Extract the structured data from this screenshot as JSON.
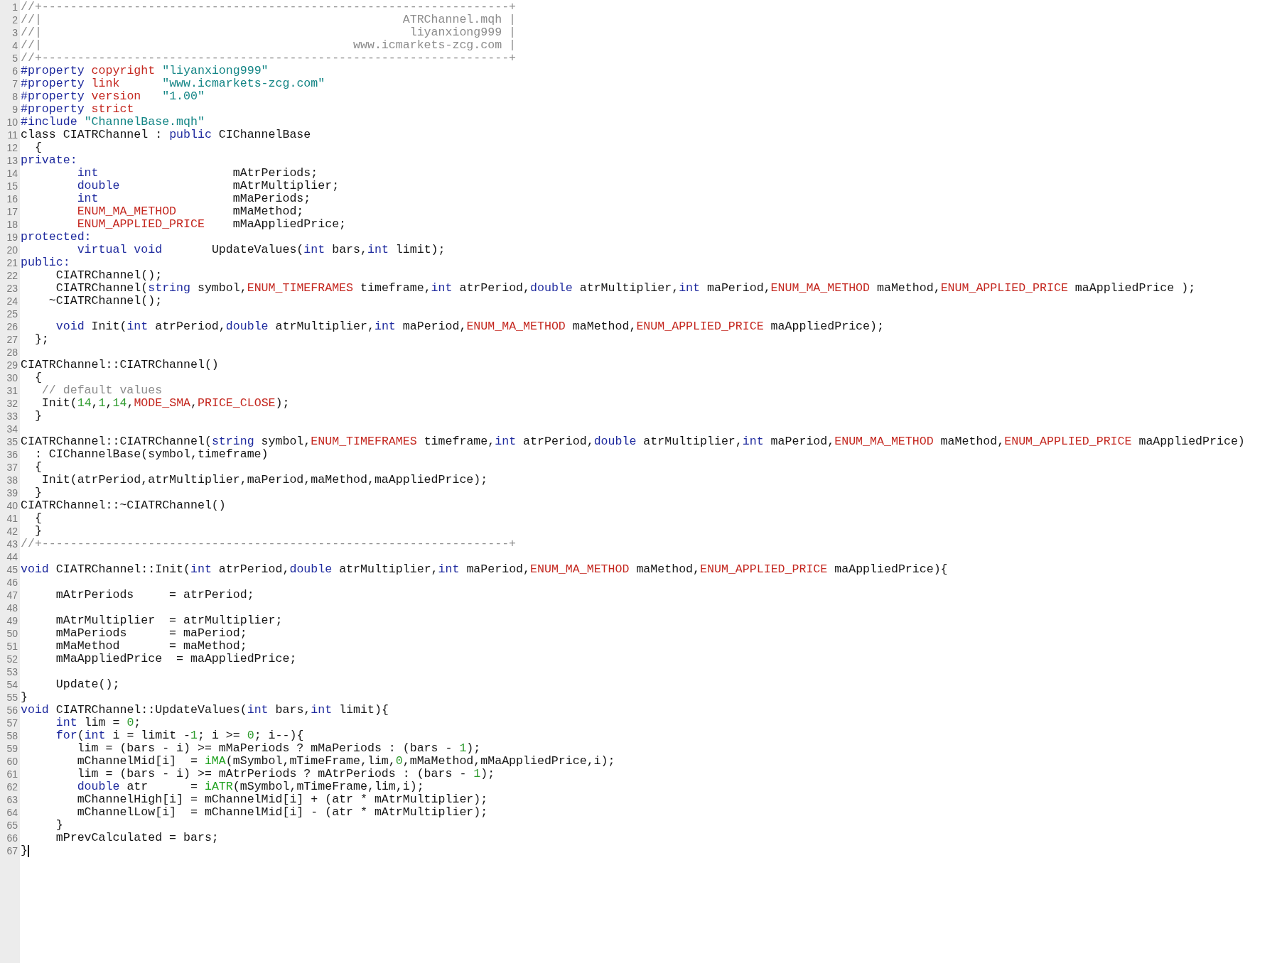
{
  "editor": {
    "lines": [
      {
        "number": "1",
        "caret": false,
        "segments": [
          {
            "text": "//+------------------------------------------------------------------+",
            "kind": "comment"
          }
        ]
      },
      {
        "number": "2",
        "caret": false,
        "segments": [
          {
            "text": "//|                                                   ATRChannel.mqh |",
            "kind": "comment"
          }
        ]
      },
      {
        "number": "3",
        "caret": false,
        "segments": [
          {
            "text": "//|                                                    liyanxiong999 |",
            "kind": "comment"
          }
        ]
      },
      {
        "number": "4",
        "caret": false,
        "segments": [
          {
            "text": "//|                                            www.icmarkets-zcg.com |",
            "kind": "comment"
          }
        ]
      },
      {
        "number": "5",
        "caret": false,
        "segments": [
          {
            "text": "//+------------------------------------------------------------------+",
            "kind": "comment"
          }
        ]
      },
      {
        "number": "6",
        "caret": false,
        "segments": [
          {
            "text": "#property ",
            "kind": "keyword"
          },
          {
            "text": "copyright",
            "kind": "type"
          },
          {
            "text": " \"liyanxiong999\"",
            "kind": "string"
          }
        ]
      },
      {
        "number": "7",
        "caret": false,
        "segments": [
          {
            "text": "#property ",
            "kind": "keyword"
          },
          {
            "text": "link",
            "kind": "type"
          },
          {
            "text": "      \"www.icmarkets-zcg.com\"",
            "kind": "string"
          }
        ]
      },
      {
        "number": "8",
        "caret": false,
        "segments": [
          {
            "text": "#property ",
            "kind": "keyword"
          },
          {
            "text": "version",
            "kind": "type"
          },
          {
            "text": "   \"1.00\"",
            "kind": "string"
          }
        ]
      },
      {
        "number": "9",
        "caret": false,
        "segments": [
          {
            "text": "#property ",
            "kind": "keyword"
          },
          {
            "text": "strict",
            "kind": "type"
          }
        ]
      },
      {
        "number": "10",
        "caret": false,
        "segments": [
          {
            "text": "#include ",
            "kind": "keyword"
          },
          {
            "text": "\"ChannelBase.mqh\"",
            "kind": "string"
          }
        ]
      },
      {
        "number": "11",
        "caret": false,
        "segments": [
          {
            "text": "class CIATRChannel : ",
            "kind": "plain"
          },
          {
            "text": "public",
            "kind": "keyword"
          },
          {
            "text": " CIChannelBase",
            "kind": "plain"
          }
        ]
      },
      {
        "number": "12",
        "caret": false,
        "segments": [
          {
            "text": "  {",
            "kind": "plain"
          }
        ]
      },
      {
        "number": "13",
        "caret": false,
        "segments": [
          {
            "text": "private:",
            "kind": "keyword"
          }
        ]
      },
      {
        "number": "14",
        "caret": false,
        "segments": [
          {
            "text": "        int",
            "kind": "keyword"
          },
          {
            "text": "                   mAtrPeriods;",
            "kind": "plain"
          }
        ]
      },
      {
        "number": "15",
        "caret": false,
        "segments": [
          {
            "text": "        double",
            "kind": "keyword"
          },
          {
            "text": "                mAtrMultiplier;",
            "kind": "plain"
          }
        ]
      },
      {
        "number": "16",
        "caret": false,
        "segments": [
          {
            "text": "        int",
            "kind": "keyword"
          },
          {
            "text": "                   mMaPeriods;",
            "kind": "plain"
          }
        ]
      },
      {
        "number": "17",
        "caret": false,
        "segments": [
          {
            "text": "        ENUM_MA_METHOD",
            "kind": "type"
          },
          {
            "text": "        mMaMethod;",
            "kind": "plain"
          }
        ]
      },
      {
        "number": "18",
        "caret": false,
        "segments": [
          {
            "text": "        ENUM_APPLIED_PRICE",
            "kind": "type"
          },
          {
            "text": "    mMaAppliedPrice;",
            "kind": "plain"
          }
        ]
      },
      {
        "number": "19",
        "caret": false,
        "segments": [
          {
            "text": "protected:",
            "kind": "keyword"
          }
        ]
      },
      {
        "number": "20",
        "caret": false,
        "segments": [
          {
            "text": "        virtual void",
            "kind": "keyword"
          },
          {
            "text": "       UpdateValues(",
            "kind": "plain"
          },
          {
            "text": "int",
            "kind": "keyword"
          },
          {
            "text": " bars,",
            "kind": "plain"
          },
          {
            "text": "int",
            "kind": "keyword"
          },
          {
            "text": " limit);",
            "kind": "plain"
          }
        ]
      },
      {
        "number": "21",
        "caret": false,
        "segments": [
          {
            "text": "public:",
            "kind": "keyword"
          }
        ]
      },
      {
        "number": "22",
        "caret": false,
        "segments": [
          {
            "text": "     CIATRChannel();",
            "kind": "plain"
          }
        ]
      },
      {
        "number": "23",
        "caret": false,
        "segments": [
          {
            "text": "     CIATRChannel(",
            "kind": "plain"
          },
          {
            "text": "string",
            "kind": "keyword"
          },
          {
            "text": " symbol,",
            "kind": "plain"
          },
          {
            "text": "ENUM_TIMEFRAMES",
            "kind": "type"
          },
          {
            "text": " timeframe,",
            "kind": "plain"
          },
          {
            "text": "int",
            "kind": "keyword"
          },
          {
            "text": " atrPeriod,",
            "kind": "plain"
          },
          {
            "text": "double",
            "kind": "keyword"
          },
          {
            "text": " atrMultiplier,",
            "kind": "plain"
          },
          {
            "text": "int",
            "kind": "keyword"
          },
          {
            "text": " maPeriod,",
            "kind": "plain"
          },
          {
            "text": "ENUM_MA_METHOD",
            "kind": "type"
          },
          {
            "text": " maMethod,",
            "kind": "plain"
          },
          {
            "text": "ENUM_APPLIED_PRICE",
            "kind": "type"
          },
          {
            "text": " maAppliedPrice );",
            "kind": "plain"
          }
        ]
      },
      {
        "number": "24",
        "caret": false,
        "segments": [
          {
            "text": "    ~CIATRChannel();",
            "kind": "plain"
          }
        ]
      },
      {
        "number": "25",
        "caret": false
      },
      {
        "number": "26",
        "caret": false,
        "segments": [
          {
            "text": "     void",
            "kind": "keyword"
          },
          {
            "text": " Init(",
            "kind": "plain"
          },
          {
            "text": "int",
            "kind": "keyword"
          },
          {
            "text": " atrPeriod,",
            "kind": "plain"
          },
          {
            "text": "double",
            "kind": "keyword"
          },
          {
            "text": " atrMultiplier,",
            "kind": "plain"
          },
          {
            "text": "int",
            "kind": "keyword"
          },
          {
            "text": " maPeriod,",
            "kind": "plain"
          },
          {
            "text": "ENUM_MA_METHOD",
            "kind": "type"
          },
          {
            "text": " maMethod,",
            "kind": "plain"
          },
          {
            "text": "ENUM_APPLIED_PRICE",
            "kind": "type"
          },
          {
            "text": " maAppliedPrice);",
            "kind": "plain"
          }
        ]
      },
      {
        "number": "27",
        "caret": false,
        "segments": [
          {
            "text": "  };",
            "kind": "plain"
          }
        ]
      },
      {
        "number": "28",
        "caret": false
      },
      {
        "number": "29",
        "caret": false,
        "segments": [
          {
            "text": "CIATRChannel::CIATRChannel()",
            "kind": "plain"
          }
        ]
      },
      {
        "number": "30",
        "caret": false,
        "segments": [
          {
            "text": "  {",
            "kind": "plain"
          }
        ]
      },
      {
        "number": "31",
        "caret": false,
        "segments": [
          {
            "text": "   // default values",
            "kind": "comment"
          }
        ]
      },
      {
        "number": "32",
        "caret": false,
        "segments": [
          {
            "text": "   Init(",
            "kind": "plain"
          },
          {
            "text": "14",
            "kind": "number"
          },
          {
            "text": ",",
            "kind": "plain"
          },
          {
            "text": "1",
            "kind": "number"
          },
          {
            "text": ",",
            "kind": "plain"
          },
          {
            "text": "14",
            "kind": "number"
          },
          {
            "text": ",",
            "kind": "plain"
          },
          {
            "text": "MODE_SMA",
            "kind": "type"
          },
          {
            "text": ",",
            "kind": "plain"
          },
          {
            "text": "PRICE_CLOSE",
            "kind": "type"
          },
          {
            "text": ");",
            "kind": "plain"
          }
        ]
      },
      {
        "number": "33",
        "caret": false,
        "segments": [
          {
            "text": "  }",
            "kind": "plain"
          }
        ]
      },
      {
        "number": "34",
        "caret": false
      },
      {
        "number": "35",
        "caret": false,
        "segments": [
          {
            "text": "CIATRChannel::CIATRChannel(",
            "kind": "plain"
          },
          {
            "text": "string",
            "kind": "keyword"
          },
          {
            "text": " symbol,",
            "kind": "plain"
          },
          {
            "text": "ENUM_TIMEFRAMES",
            "kind": "type"
          },
          {
            "text": " timeframe,",
            "kind": "plain"
          },
          {
            "text": "int",
            "kind": "keyword"
          },
          {
            "text": " atrPeriod,",
            "kind": "plain"
          },
          {
            "text": "double",
            "kind": "keyword"
          },
          {
            "text": " atrMultiplier,",
            "kind": "plain"
          },
          {
            "text": "int",
            "kind": "keyword"
          },
          {
            "text": " maPeriod,",
            "kind": "plain"
          },
          {
            "text": "ENUM_MA_METHOD",
            "kind": "type"
          },
          {
            "text": " maMethod,",
            "kind": "plain"
          },
          {
            "text": "ENUM_APPLIED_PRICE",
            "kind": "type"
          },
          {
            "text": " maAppliedPrice)",
            "kind": "plain"
          }
        ]
      },
      {
        "number": "36",
        "caret": false,
        "segments": [
          {
            "text": "  : CIChannelBase(symbol,timeframe)",
            "kind": "plain"
          }
        ]
      },
      {
        "number": "37",
        "caret": false,
        "segments": [
          {
            "text": "  {",
            "kind": "plain"
          }
        ]
      },
      {
        "number": "38",
        "caret": false,
        "segments": [
          {
            "text": "   Init(atrPeriod,atrMultiplier,maPeriod,maMethod,maAppliedPrice);",
            "kind": "plain"
          }
        ]
      },
      {
        "number": "39",
        "caret": false,
        "segments": [
          {
            "text": "  }",
            "kind": "plain"
          }
        ]
      },
      {
        "number": "40",
        "caret": false,
        "segments": [
          {
            "text": "CIATRChannel::~CIATRChannel()",
            "kind": "plain"
          }
        ]
      },
      {
        "number": "41",
        "caret": false,
        "segments": [
          {
            "text": "  {",
            "kind": "plain"
          }
        ]
      },
      {
        "number": "42",
        "caret": false,
        "segments": [
          {
            "text": "  }",
            "kind": "plain"
          }
        ]
      },
      {
        "number": "43",
        "caret": false,
        "segments": [
          {
            "text": "//+------------------------------------------------------------------+",
            "kind": "comment"
          }
        ]
      },
      {
        "number": "44",
        "caret": false
      },
      {
        "number": "45",
        "caret": false,
        "segments": [
          {
            "text": "void",
            "kind": "keyword"
          },
          {
            "text": " CIATRChannel::Init(",
            "kind": "plain"
          },
          {
            "text": "int",
            "kind": "keyword"
          },
          {
            "text": " atrPeriod,",
            "kind": "plain"
          },
          {
            "text": "double",
            "kind": "keyword"
          },
          {
            "text": " atrMultiplier,",
            "kind": "plain"
          },
          {
            "text": "int",
            "kind": "keyword"
          },
          {
            "text": " maPeriod,",
            "kind": "plain"
          },
          {
            "text": "ENUM_MA_METHOD",
            "kind": "type"
          },
          {
            "text": " maMethod,",
            "kind": "plain"
          },
          {
            "text": "ENUM_APPLIED_PRICE",
            "kind": "type"
          },
          {
            "text": " maAppliedPrice){",
            "kind": "plain"
          }
        ]
      },
      {
        "number": "46",
        "caret": false
      },
      {
        "number": "47",
        "caret": false,
        "segments": [
          {
            "text": "     mAtrPeriods     = atrPeriod;",
            "kind": "plain"
          }
        ]
      },
      {
        "number": "48",
        "caret": false
      },
      {
        "number": "49",
        "caret": false,
        "segments": [
          {
            "text": "     mAtrMultiplier  = atrMultiplier;",
            "kind": "plain"
          }
        ]
      },
      {
        "number": "50",
        "caret": false,
        "segments": [
          {
            "text": "     mMaPeriods      = maPeriod;",
            "kind": "plain"
          }
        ]
      },
      {
        "number": "51",
        "caret": false,
        "segments": [
          {
            "text": "     mMaMethod       = maMethod;",
            "kind": "plain"
          }
        ]
      },
      {
        "number": "52",
        "caret": false,
        "segments": [
          {
            "text": "     mMaAppliedPrice  = maAppliedPrice;",
            "kind": "plain"
          }
        ]
      },
      {
        "number": "53",
        "caret": false
      },
      {
        "number": "54",
        "caret": false,
        "segments": [
          {
            "text": "     Update();",
            "kind": "plain"
          }
        ]
      },
      {
        "number": "55",
        "caret": false,
        "segments": [
          {
            "text": "}",
            "kind": "plain"
          }
        ]
      },
      {
        "number": "56",
        "caret": false,
        "segments": [
          {
            "text": "void",
            "kind": "keyword"
          },
          {
            "text": " CIATRChannel::UpdateValues(",
            "kind": "plain"
          },
          {
            "text": "int",
            "kind": "keyword"
          },
          {
            "text": " bars,",
            "kind": "plain"
          },
          {
            "text": "int",
            "kind": "keyword"
          },
          {
            "text": " limit){",
            "kind": "plain"
          }
        ]
      },
      {
        "number": "57",
        "caret": false,
        "segments": [
          {
            "text": "     int",
            "kind": "keyword"
          },
          {
            "text": " lim = ",
            "kind": "plain"
          },
          {
            "text": "0",
            "kind": "number"
          },
          {
            "text": ";",
            "kind": "plain"
          }
        ]
      },
      {
        "number": "58",
        "caret": false,
        "segments": [
          {
            "text": "     for",
            "kind": "keyword"
          },
          {
            "text": "(",
            "kind": "plain"
          },
          {
            "text": "int",
            "kind": "keyword"
          },
          {
            "text": " i = limit -",
            "kind": "plain"
          },
          {
            "text": "1",
            "kind": "number"
          },
          {
            "text": "; i >= ",
            "kind": "plain"
          },
          {
            "text": "0",
            "kind": "number"
          },
          {
            "text": "; i--){",
            "kind": "plain"
          }
        ]
      },
      {
        "number": "59",
        "caret": false,
        "segments": [
          {
            "text": "        lim = (bars - i) >= mMaPeriods ? mMaPeriods : (bars - ",
            "kind": "plain"
          },
          {
            "text": "1",
            "kind": "number"
          },
          {
            "text": ");",
            "kind": "plain"
          }
        ]
      },
      {
        "number": "60",
        "caret": false,
        "segments": [
          {
            "text": "        mChannelMid[i]  = ",
            "kind": "plain"
          },
          {
            "text": "iMA",
            "kind": "function"
          },
          {
            "text": "(mSymbol,mTimeFrame,lim,",
            "kind": "plain"
          },
          {
            "text": "0",
            "kind": "number"
          },
          {
            "text": ",mMaMethod,mMaAppliedPrice,i);",
            "kind": "plain"
          }
        ]
      },
      {
        "number": "61",
        "caret": false,
        "segments": [
          {
            "text": "        lim = (bars - i) >= mAtrPeriods ? mAtrPeriods : (bars - ",
            "kind": "plain"
          },
          {
            "text": "1",
            "kind": "number"
          },
          {
            "text": ");",
            "kind": "plain"
          }
        ]
      },
      {
        "number": "62",
        "caret": false,
        "segments": [
          {
            "text": "        double",
            "kind": "keyword"
          },
          {
            "text": " atr      = ",
            "kind": "plain"
          },
          {
            "text": "iATR",
            "kind": "function"
          },
          {
            "text": "(mSymbol,mTimeFrame,lim,i);",
            "kind": "plain"
          }
        ]
      },
      {
        "number": "63",
        "caret": false,
        "segments": [
          {
            "text": "        mChannelHigh[i] = mChannelMid[i] + (atr * mAtrMultiplier);",
            "kind": "plain"
          }
        ]
      },
      {
        "number": "64",
        "caret": false,
        "segments": [
          {
            "text": "        mChannelLow[i]  = mChannelMid[i] - (atr * mAtrMultiplier);",
            "kind": "plain"
          }
        ]
      },
      {
        "number": "65",
        "caret": false,
        "segments": [
          {
            "text": "     }",
            "kind": "plain"
          }
        ]
      },
      {
        "number": "66",
        "caret": false,
        "segments": [
          {
            "text": "     mPrevCalculated = bars;",
            "kind": "plain"
          }
        ]
      },
      {
        "number": "67",
        "caret": true,
        "segments": [
          {
            "text": "}",
            "kind": "plain"
          }
        ]
      }
    ]
  }
}
